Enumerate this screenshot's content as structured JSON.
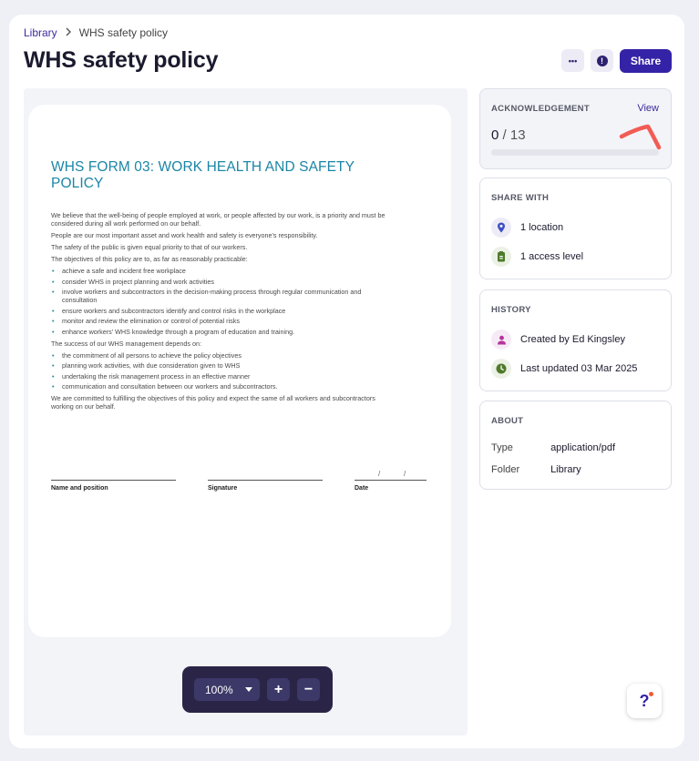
{
  "breadcrumb": {
    "parent": "Library",
    "current": "WHS safety policy"
  },
  "page": {
    "title": "WHS safety policy",
    "more_label": "•••",
    "info_label": "!",
    "share_label": "Share"
  },
  "document": {
    "title": "WHS FORM 03: WORK HEALTH AND SAFETY POLICY",
    "p1": "We believe that the well-being of people employed at work, or people affected by our work, is a priority and must be considered during all work performed on our behalf.",
    "p2": "People are our most important asset and work health and safety is everyone's responsibility.",
    "p3": "The safety of the public is given equal priority to that of our workers.",
    "p4": "The objectives of this policy are to, as far as reasonably practicable:",
    "objectives": [
      "achieve a safe and incident free workplace",
      "consider WHS in project planning and work activities",
      "involve workers and subcontractors in the decision-making process through regular communication and consultation",
      "ensure workers and subcontractors identify and control risks in the workplace",
      "monitor and review the elimination or control of potential risks",
      "enhance workers' WHS knowledge through a program of education and training."
    ],
    "p5": "The success of our WHS management depends on:",
    "depends": [
      "the commitment of all persons to achieve the policy objectives",
      "planning work activities, with due consideration given to WHS",
      "undertaking the risk management process in an effective manner",
      "communication and consultation between our workers and subcontractors."
    ],
    "p6": "We are committed to fulfilling the objectives of this policy and expect the same of all workers and subcontractors working on our behalf.",
    "sig_name": "Name and position",
    "sig_signature": "Signature",
    "sig_date": "Date",
    "date_sep": "/"
  },
  "zoom": {
    "level": "100%",
    "plus": "+",
    "minus": "−"
  },
  "acknowledgement": {
    "heading": "ACKNOWLEDGEMENT",
    "view_label": "View",
    "count": "0",
    "total": "/ 13",
    "progress": 0
  },
  "share_with": {
    "heading": "SHARE WITH",
    "location": "1 location",
    "access": "1 access level"
  },
  "history": {
    "heading": "HISTORY",
    "created": "Created by Ed Kingsley",
    "updated": "Last updated 03 Mar 2025"
  },
  "about": {
    "heading": "ABOUT",
    "type_label": "Type",
    "type_value": "application/pdf",
    "folder_label": "Folder",
    "folder_value": "Library"
  },
  "help": {
    "label": "?"
  },
  "colors": {
    "accent": "#3423a6",
    "doc_title": "#1b86a6",
    "annotation": "#f25c54"
  }
}
